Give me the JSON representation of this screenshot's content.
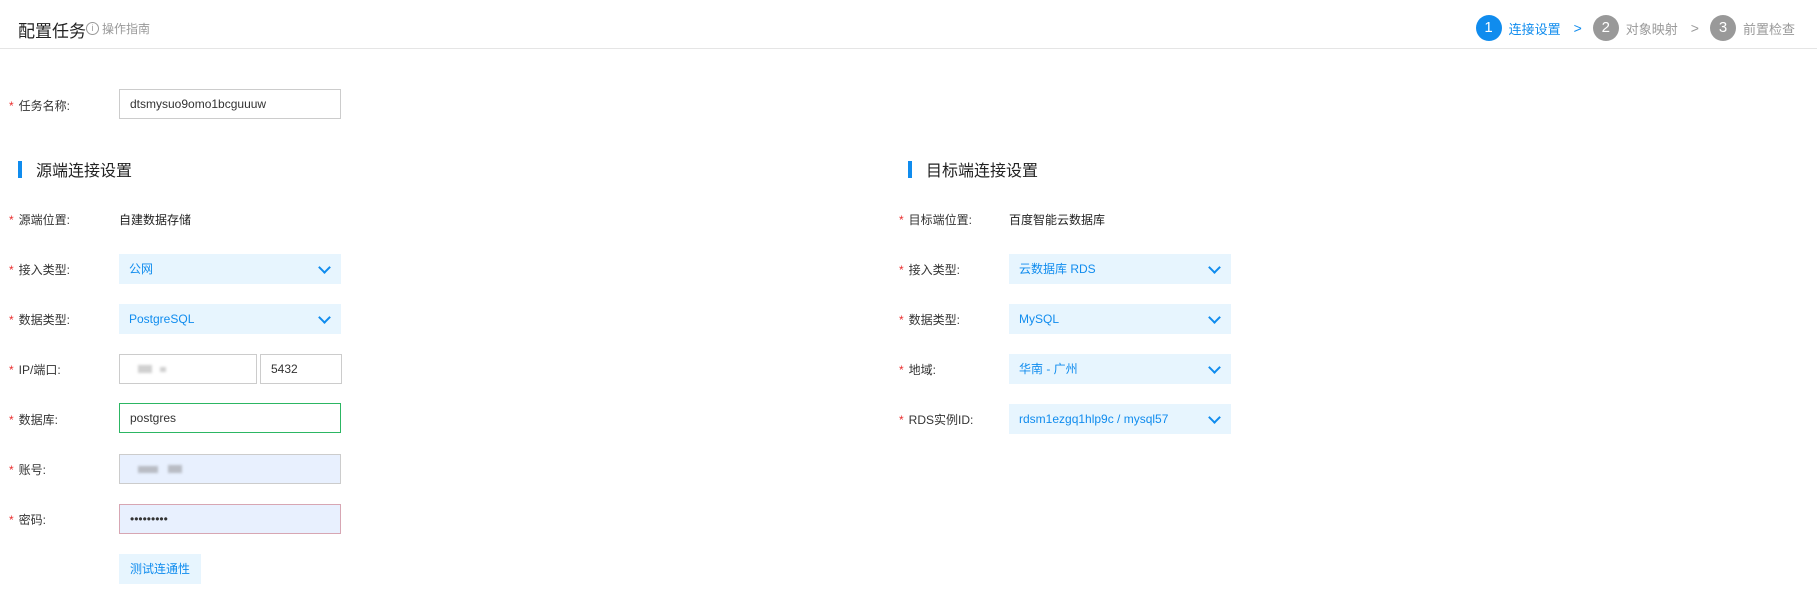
{
  "header": {
    "title": "配置任务",
    "guide_link": "操作指南",
    "steps": [
      {
        "num": "1",
        "label": "连接设置"
      },
      {
        "num": "2",
        "label": "对象映射"
      },
      {
        "num": "3",
        "label": "前置检查"
      }
    ]
  },
  "task": {
    "name_label": "任务名称:",
    "name_value": "dtsmysuo9omo1bcguuuw"
  },
  "source": {
    "section_title": "源端连接设置",
    "location_label": "源端位置:",
    "location_value": "自建数据存储",
    "access_label": "接入类型:",
    "access_value": "公网",
    "dbtype_label": "数据类型:",
    "dbtype_value": "PostgreSQL",
    "ipport_label": "IP/端口:",
    "port_value": "5432",
    "database_label": "数据库:",
    "database_value": "postgres",
    "account_label": "账号:",
    "password_label": "密码:",
    "password_value": "•••••••••",
    "test_button": "测试连通性"
  },
  "target": {
    "section_title": "目标端连接设置",
    "location_label": "目标端位置:",
    "location_value": "百度智能云数据库",
    "access_label": "接入类型:",
    "access_value": "云数据库 RDS",
    "dbtype_label": "数据类型:",
    "dbtype_value": "MySQL",
    "region_label": "地域:",
    "region_value": "华南 - 广州",
    "instance_label": "RDS实例ID:",
    "instance_value": "rdsm1ezgq1hlp9c / mysql57"
  },
  "colors": {
    "accent": "#108cee",
    "required": "#ea2e2e",
    "select_bg": "#e7f5fe",
    "focus_border": "#2cb663"
  },
  "icons": {
    "info": "info-icon",
    "step_separator": "chevron-right-icon",
    "select_arrow": "chevron-down-icon"
  }
}
